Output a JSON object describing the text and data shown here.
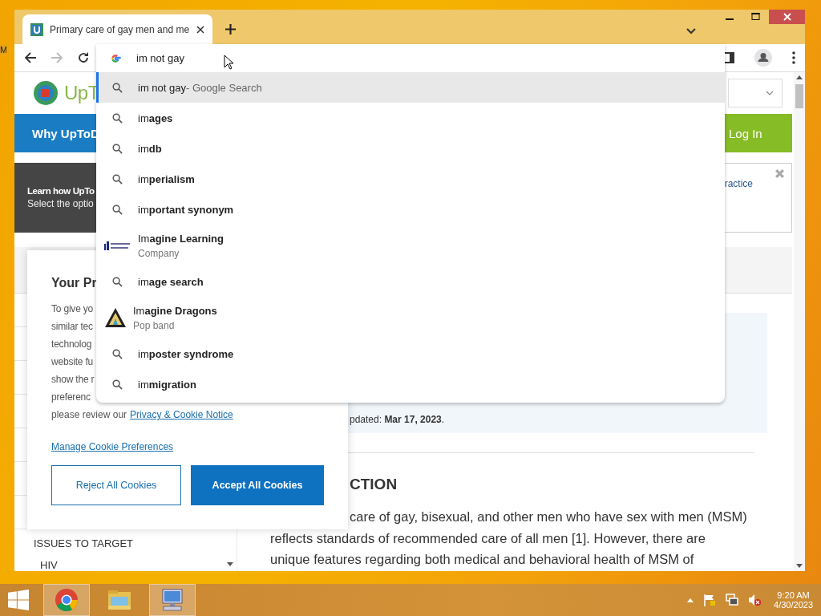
{
  "desktop": {
    "icon_label": "M"
  },
  "browser": {
    "tab": {
      "title": "Primary care of gay men and me",
      "selected": true
    },
    "address": {
      "value": "im not gay"
    }
  },
  "suggestions": [
    {
      "kind": "search",
      "text": "im not gay",
      "suffix": "- Google Search",
      "selected": true
    },
    {
      "kind": "search",
      "text": "im**ages**",
      "selected": false
    },
    {
      "kind": "search",
      "text": "im**db**",
      "selected": false
    },
    {
      "kind": "search",
      "text": "im**perialism**",
      "selected": false
    },
    {
      "kind": "search",
      "text": "im**portant synonym**",
      "selected": false
    },
    {
      "kind": "company",
      "text": "Im**agine Learning**",
      "subtitle": "Company",
      "selected": false
    },
    {
      "kind": "search",
      "text": "im**age search**",
      "selected": false
    },
    {
      "kind": "band",
      "text": "Im**agine Dragons**",
      "subtitle": "Pop band",
      "selected": false
    },
    {
      "kind": "search",
      "text": "im**poster syndrome**",
      "selected": false
    },
    {
      "kind": "search",
      "text": "im**migration**",
      "selected": false
    }
  ],
  "page": {
    "logo_text": "UpT",
    "nav_link": "Why UpToD",
    "login": "Log In",
    "banner": {
      "title": "Learn how UpTo",
      "text": "Select the optio",
      "right_text": "ractice"
    },
    "sidebar": {
      "heading": "ISSUES TO TARGET",
      "items": [
        "HIV"
      ]
    },
    "article": {
      "updated": "pdated: **Mar 17, 2023**.",
      "heading": "CTION",
      "lines": [
        "care of gay, bisexual, and other men who have sex with men (MSM)",
        "reflects standards of recommended care of all men [1]. However, there are",
        "unique features regarding both medical and behavioral health of MSM of"
      ]
    }
  },
  "cookie_dialog": {
    "title": "Your Pr",
    "lines": [
      "To give yo",
      "similar tec",
      "technolog",
      "website fu",
      "show the r",
      "preferenc"
    ],
    "review_text": "please review our",
    "privacy_link": "Privacy & Cookie Notice",
    "manage_link": "Manage Cookie Preferences",
    "reject": "Reject All Cookies",
    "accept": "Accept All Cookies"
  },
  "taskbar": {
    "apps": [
      {
        "kind": "chrome",
        "active": true
      },
      {
        "kind": "explorer",
        "active": false
      },
      {
        "kind": "remote",
        "active": true
      }
    ],
    "time": "9:20 AM",
    "date": "4/30/2023"
  }
}
